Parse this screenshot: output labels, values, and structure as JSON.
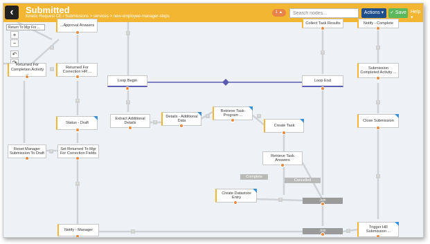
{
  "header": {
    "title": "Submitted",
    "breadcrumb": "Kinetic Request CE / Submissions > services > new-employee-manager-steps",
    "badge": "1 ▲",
    "search_placeholder": "Search nodes...",
    "actions_label": "Actions ▾",
    "save_label": "✓ Save",
    "help_label": "Help ▾"
  },
  "tools": {
    "return_label": "Return To Mgr For ...",
    "zoom_in": "+",
    "zoom_out": "−",
    "undo": "↶",
    "redo": "↷",
    "info": "i"
  },
  "nodes": {
    "approval_answers": "...Approval Answers",
    "collect_task_results": "Collect Task Results",
    "notify_complete": "Notify - Complete",
    "returned_for_completion": "Returned For Completion Activity ...",
    "returned_for_correction_hr": "Returned For Correction HR ...",
    "submission_completed": "Submission Completed Activity ...",
    "loop_begin": "Loop Begin",
    "loop_end": "Loop End",
    "retrieve_task_program": "Retrieve Task-Program ...",
    "extract_additional_details": "Extract Additional Details",
    "details_additional_data": "Details - Additional Data",
    "create_task": "Create Task",
    "status_draft": "Status - Draft",
    "close_submission": "Close Submission",
    "reset_manager_submission": "Reset Manager Submission To Draft",
    "set_returned_to_mgr": "Set Returned To Mgr For Correction Fields",
    "retrieve_task_answers": "Retrieve Task Answers",
    "create_datastore_entry": "Create Datastore Entry",
    "notify_manager": "Notify - Manager",
    "trigger_hr_submission": "Trigger HR Submission ...",
    "join_1": "Join",
    "join_2": "Join"
  },
  "connector_labels": {
    "complete": "Complete",
    "cancelled": "Cancelled"
  },
  "colors": {
    "header": "#f2b632",
    "node_accent": "#f2b632",
    "node_corner": "#3a8fd6",
    "dot": "#e98a3e",
    "loop_line": "#5a5ab0",
    "actions_button": "#1f4e8c",
    "save_button": "#5cb85c"
  }
}
